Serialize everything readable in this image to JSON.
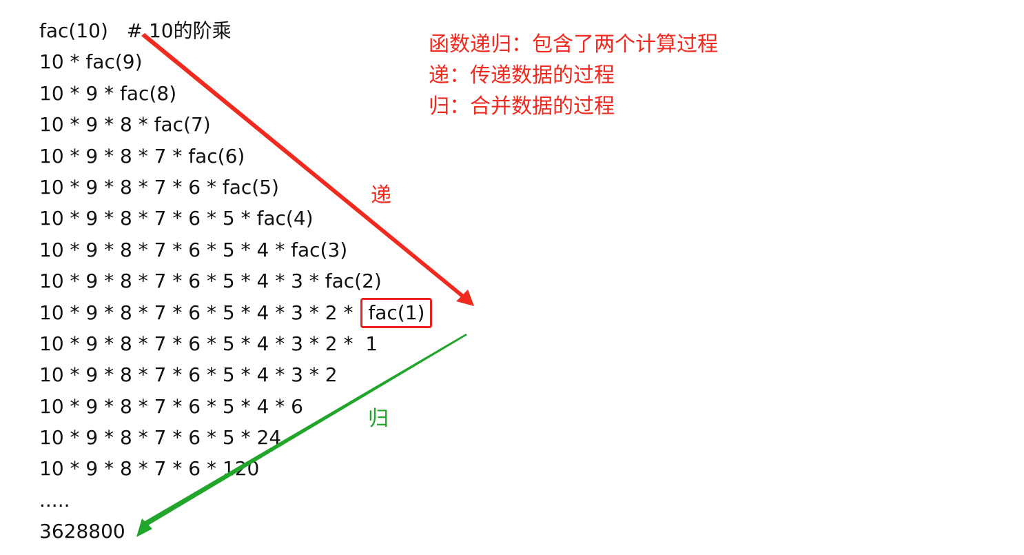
{
  "trace": {
    "lines": [
      {
        "text": "fac(10)   # 10的阶乘"
      },
      {
        "text": "10 * fac(9)"
      },
      {
        "text": "10 * 9 * fac(8)"
      },
      {
        "text": "10 * 9 * 8 * fac(7)"
      },
      {
        "text": "10 * 9 * 8 * 7 * fac(6)"
      },
      {
        "text": "10 * 9 * 8 * 7 * 6 * fac(5)"
      },
      {
        "text": "10 * 9 * 8 * 7 * 6 * 5 * fac(4)"
      },
      {
        "text": "10 * 9 * 8 * 7 * 6 * 5 * 4 * fac(3)"
      },
      {
        "text": "10 * 9 * 8 * 7 * 6 * 5 * 4 * 3 * fac(2)"
      },
      {
        "text": "10 * 9 * 8 * 7 * 6 * 5 * 4 * 3 * 2 * ",
        "boxed": "fac(1)"
      },
      {
        "text": "10 * 9 * 8 * 7 * 6 * 5 * 4 * 3 * 2 *  1"
      },
      {
        "text": "10 * 9 * 8 * 7 * 6 * 5 * 4 * 3 * 2"
      },
      {
        "text": "10 * 9 * 8 * 7 * 6 * 5 * 4 * 6"
      },
      {
        "text": "10 * 9 * 8 * 7 * 6 * 5 * 24"
      },
      {
        "text": "10 * 9 * 8 * 7 * 6 * 120"
      },
      {
        "text": "....."
      },
      {
        "text": "3628800"
      }
    ]
  },
  "notes": {
    "title": "函数递归：包含了两个计算过程",
    "recursion": "递：传递数据的过程",
    "return": "归：合并数据的过程"
  },
  "labels": {
    "di": "递",
    "gui": "归"
  },
  "colors": {
    "red": "#f02a1f",
    "green": "#22a52b",
    "text": "#111111"
  }
}
